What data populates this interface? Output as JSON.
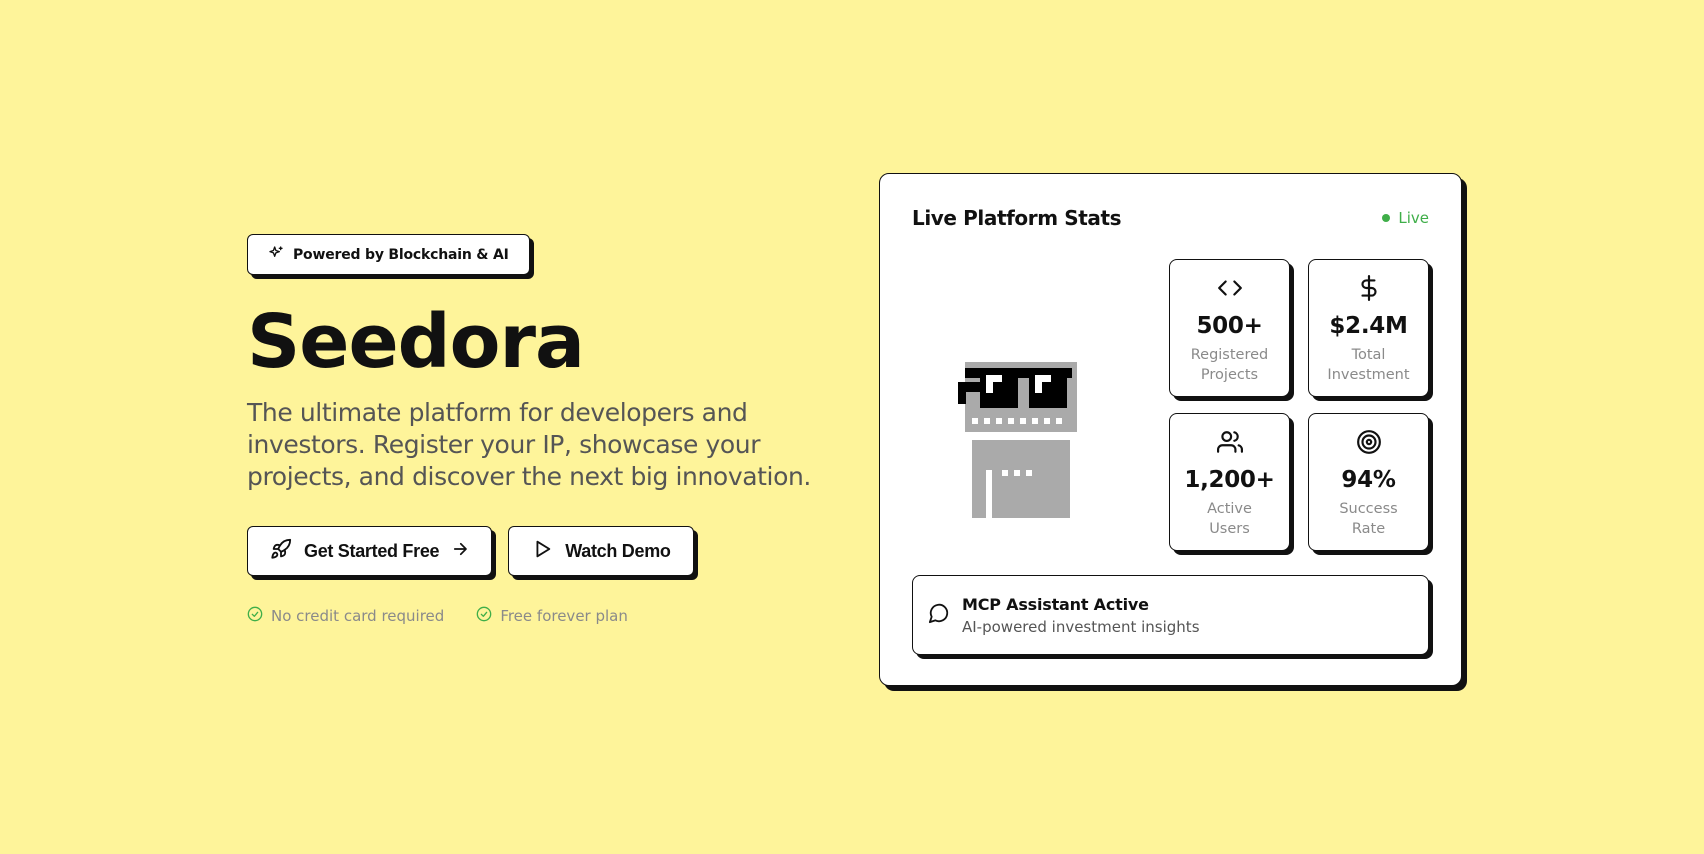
{
  "colors": {
    "background": "#fef49a",
    "border": "#111111",
    "live_green": "#3fae49",
    "muted_text": "#8a8a8a",
    "mascot_grey": "#aaaaaa"
  },
  "badge": {
    "icon": "sparkles-icon",
    "label": "Powered by Blockchain & AI"
  },
  "hero": {
    "title": "Seedora",
    "subtitle": "The ultimate platform for developers and investors. Register your IP, showcase your projects, and discover the next big innovation."
  },
  "cta": {
    "primary": {
      "icon": "rocket-icon",
      "label": "Get Started Free",
      "trailing_icon": "arrow-right-icon"
    },
    "secondary": {
      "icon": "play-icon",
      "label": "Watch Demo"
    }
  },
  "perks": [
    {
      "icon": "check-circle-icon",
      "label": "No credit card required"
    },
    {
      "icon": "check-circle-icon",
      "label": "Free forever plan"
    }
  ],
  "stats_card": {
    "title": "Live Platform Stats",
    "live_label": "Live",
    "stats": [
      {
        "icon": "code-icon",
        "value": "500+",
        "label": "Registered Projects"
      },
      {
        "icon": "dollar-icon",
        "value": "$2.4M",
        "label": "Total Investment"
      },
      {
        "icon": "users-icon",
        "value": "1,200+",
        "label": "Active Users"
      },
      {
        "icon": "target-icon",
        "value": "94%",
        "label": "Success Rate"
      }
    ],
    "assistant": {
      "icon": "message-circle-icon",
      "title": "MCP Assistant Active",
      "subtitle": "AI-powered investment insights"
    }
  }
}
